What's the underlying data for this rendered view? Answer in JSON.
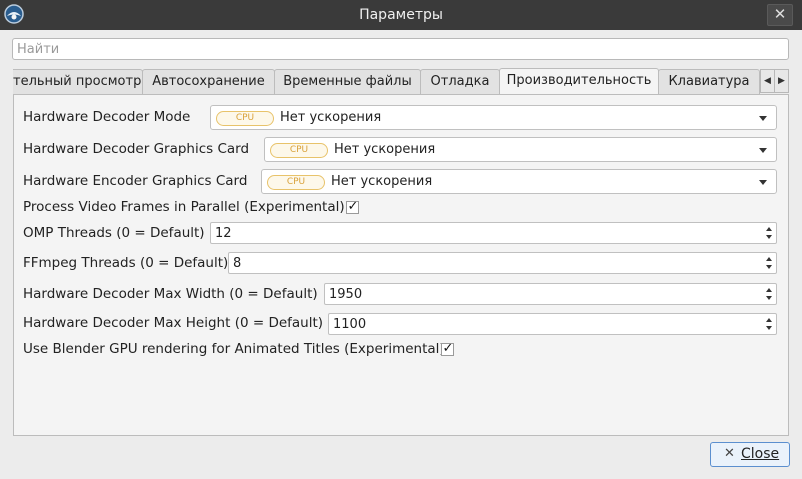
{
  "window": {
    "title": "Параметры",
    "close_glyph": "✕",
    "app_icon": "openshot-icon"
  },
  "search": {
    "placeholder": "Найти",
    "value": ""
  },
  "tabs": [
    {
      "label": "тельный просмотр",
      "active": false
    },
    {
      "label": "Автосохранение",
      "active": false
    },
    {
      "label": "Временные файлы",
      "active": false
    },
    {
      "label": "Отладка",
      "active": false
    },
    {
      "label": "Производительность",
      "active": true
    },
    {
      "label": "Клавиатура",
      "active": false
    }
  ],
  "tab_scroll": {
    "left": "◀",
    "right": "▶"
  },
  "settings": {
    "decoder_mode": {
      "label": "Hardware Decoder Mode",
      "badge": "CPU",
      "value": "Нет ускорения"
    },
    "decoder_card": {
      "label": "Hardware Decoder Graphics Card",
      "badge": "CPU",
      "value": "Нет ускорения"
    },
    "encoder_card": {
      "label": "Hardware Encoder Graphics Card",
      "badge": "CPU",
      "value": "Нет ускорения"
    },
    "parallel_frames": {
      "label": "Process Video Frames in Parallel (Experimental)",
      "checked": true,
      "mark": "✓"
    },
    "omp_threads": {
      "label": "OMP Threads (0 = Default)",
      "value": "12"
    },
    "ffmpeg_threads": {
      "label": "FFmpeg Threads (0 = Default)",
      "value": "8"
    },
    "max_width": {
      "label": "Hardware Decoder Max Width (0 = Default)",
      "value": "1950"
    },
    "max_height": {
      "label": "Hardware Decoder Max Height (0 = Default)",
      "value": "1100"
    },
    "blender_gpu": {
      "label": "Use Blender GPU rendering for Animated Titles (Experimental)",
      "checked": true,
      "mark": "✓"
    }
  },
  "footer": {
    "close_icon": "✕",
    "close_label": "Close"
  },
  "colors": {
    "titlebar": "#3a3a3a",
    "badge_border": "#e8c36a",
    "badge_text": "#d9a23b",
    "close_button_border": "#5b8fcf"
  }
}
